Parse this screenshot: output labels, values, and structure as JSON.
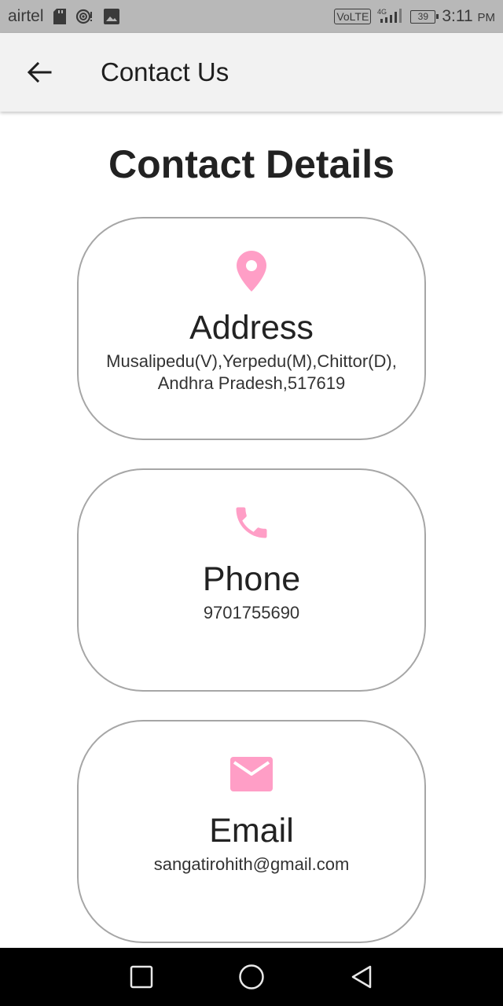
{
  "status_bar": {
    "carrier": "airtel",
    "icons": [
      "sd-card-icon",
      "hotspot-icon",
      "gallery-icon",
      "signal-icon",
      "battery-icon"
    ],
    "volte": "VoLTE",
    "network": "4G",
    "battery_level": "39",
    "time": "3:11",
    "meridiem": "PM"
  },
  "app_bar": {
    "back_icon": "arrow-back-icon",
    "title": "Contact Us"
  },
  "page": {
    "title": "Contact Details",
    "accent_color": "#ff9ec6",
    "cards": [
      {
        "icon": "location-pin-icon",
        "heading": "Address",
        "value": "Musalipedu(V),Yerpedu(M),Chittor(D),Andhra Pradesh,517619"
      },
      {
        "icon": "phone-icon",
        "heading": "Phone",
        "value": "9701755690"
      },
      {
        "icon": "mail-icon",
        "heading": "Email",
        "value": "sangatirohith@gmail.com"
      }
    ]
  },
  "nav_bar": {
    "buttons": [
      "recents-square-icon",
      "home-circle-icon",
      "back-triangle-icon"
    ]
  }
}
